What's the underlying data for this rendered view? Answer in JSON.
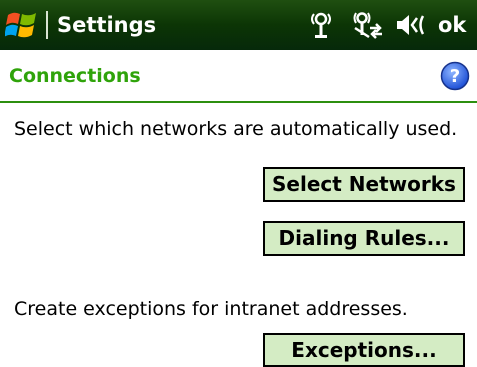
{
  "titlebar": {
    "title": "Settings",
    "ok_label": "ok",
    "icons": [
      "windows-logo",
      "antenna-signal",
      "connectivity",
      "speaker-volume"
    ]
  },
  "header": {
    "title": "Connections",
    "help_icon": "help-icon"
  },
  "content": {
    "networks_text": "Select which networks are automatically used.",
    "select_networks_label": "Select Networks",
    "dialing_rules_label": "Dialing Rules...",
    "exceptions_text": "Create exceptions for intranet addresses.",
    "exceptions_label": "Exceptions..."
  },
  "colors": {
    "titlebar_bg": "#0c3505",
    "heading": "#2fa30a",
    "rule": "#2c8f0f",
    "button_bg": "#d4ecc4"
  }
}
